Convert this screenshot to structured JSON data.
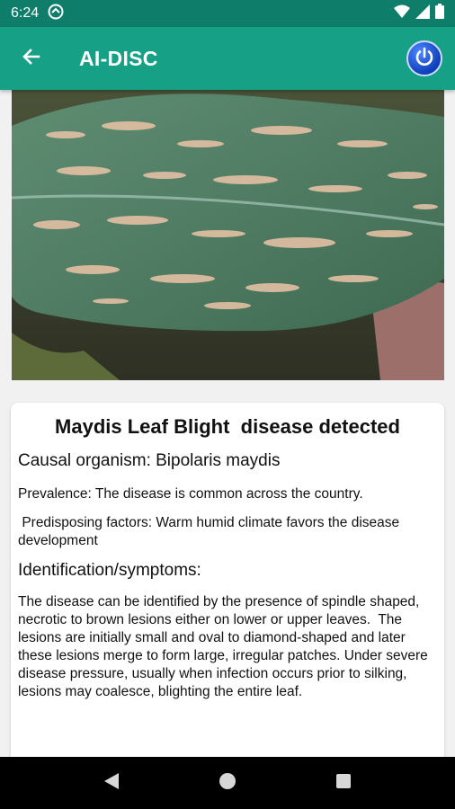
{
  "status_bar": {
    "time": "6:24",
    "icons": [
      "sync-icon",
      "wifi-icon",
      "signal-icon",
      "battery-icon"
    ]
  },
  "app_bar": {
    "title": "AI-DISC",
    "back_icon": "arrow-left-icon",
    "power_icon": "power-icon"
  },
  "image": {
    "subject": "maize-leaf-with-blight-lesions"
  },
  "card": {
    "title": "Maydis Leaf Blight  disease detected",
    "causal": "Causal organism: Bipolaris maydis",
    "prevalence": "Prevalence: The disease is common across the country.",
    "predisposing": " Predisposing factors: Warm humid climate favors the disease development",
    "symptoms_heading": "Identification/symptoms:",
    "symptoms_text": "The disease can be identified by the presence of spindle shaped, necrotic to brown lesions either on lower or upper leaves.  The lesions are initially small and oval to diamond-shaped and later these lesions merge to form large, irregular patches. Under severe disease pressure, usually when infection occurs prior to silking, lesions may coalesce, blighting the entire leaf."
  },
  "nav_bar": {
    "buttons": [
      "back-nav-icon",
      "home-nav-icon",
      "recents-nav-icon"
    ]
  },
  "colors": {
    "status_bar": "#0e7d6a",
    "app_bar": "#16a085",
    "power_button": "#1a4fd8"
  }
}
